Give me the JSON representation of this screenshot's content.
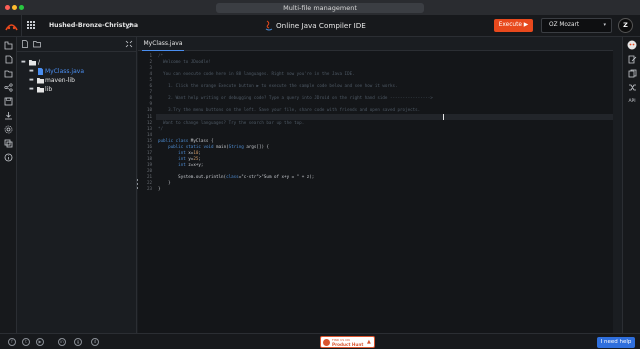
{
  "os_window": {
    "title": "Multi-file management"
  },
  "header": {
    "project_name": "Hushed-Bronze-Christyna",
    "app_title": "Online Java Compiler IDE",
    "execute_label": "Execute ▶",
    "language_selected": "OZ Mozart",
    "user_initials": "Z"
  },
  "file_tree": {
    "root": "/",
    "items": [
      {
        "label": "MyClass.java",
        "type": "file",
        "selected": true
      },
      {
        "label": "maven-lib",
        "type": "folder"
      },
      {
        "label": "lib",
        "type": "folder"
      }
    ]
  },
  "editor": {
    "active_tab": "MyClass.java",
    "line_numbers": [
      "1",
      "2",
      "3",
      "4",
      "5",
      "6",
      "7",
      "8",
      "9",
      "10",
      "11",
      "12",
      "13",
      "14",
      "15",
      "16",
      "17",
      "18",
      "19",
      "20",
      "21",
      "22",
      "23"
    ],
    "lines": [
      "/*",
      "  Welcome to JDoodle!",
      "",
      "  You can execute code here in 88 languages. Right now you're in the Java IDE.",
      "",
      "    1. Click the orange Execute button ▶ to execute the sample code below and see how it works.",
      "",
      "    2. Want help writing or debugging code? Type a query into JDroid on the right hand side ---------------->",
      "",
      "    3.Try the menu buttons on the left. Save your file, share code with friends and open saved projects.",
      "",
      "  Want to change languages? Try the search bar up the top.",
      "*/",
      "",
      "public class MyClass {",
      "    public static void main(String args[]) {",
      "        int x=10;",
      "        int y=25;",
      "        int z=x+y;",
      "",
      "        System.out.println(\"Sum of x+y = \" + z);",
      "    }",
      "}"
    ]
  },
  "right_rail": {
    "api_label": "API"
  },
  "footer": {
    "product_hunt_small": "FIND US ON",
    "product_hunt_big": "Product Hunt",
    "help_label": "I need help"
  },
  "colors": {
    "accent_orange": "#e8491d",
    "accent_blue": "#2f6fdd",
    "selected_file": "#4a8ef0",
    "background": "#1a1d21"
  }
}
